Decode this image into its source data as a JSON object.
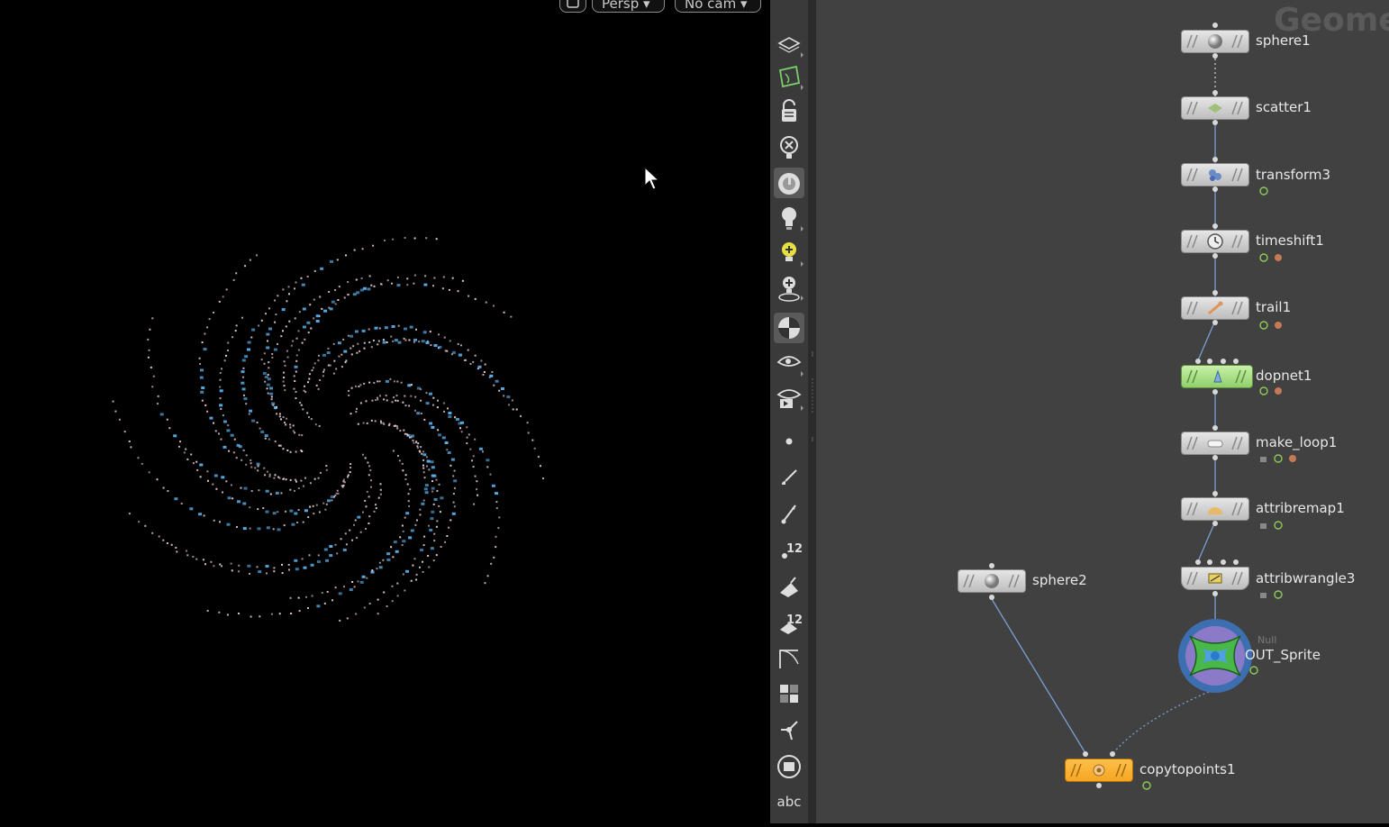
{
  "viewport": {
    "camera_menu": "Persp",
    "cam_menu": "No cam",
    "particle_colors": {
      "blue": "#5aaee8",
      "pink": "#e8cbd6"
    }
  },
  "toolbar": {
    "items": [
      "select-mode",
      "ghost-mode",
      "lock",
      "close",
      "display-options",
      "light-bulb",
      "headlight",
      "add-light",
      "shading",
      "snapshot",
      "camera-flipbook",
      "point",
      "brush",
      "pen",
      "point-numbers",
      "paint",
      "primitive-numbers",
      "shape",
      "grid",
      "handle",
      "circle-display"
    ],
    "text_button": "abc"
  },
  "network": {
    "title": "Geome",
    "nodes": [
      {
        "id": "sphere1",
        "label": "sphere1"
      },
      {
        "id": "scatter1",
        "label": "scatter1"
      },
      {
        "id": "transform3",
        "label": "transform3"
      },
      {
        "id": "timeshift1",
        "label": "timeshift1"
      },
      {
        "id": "trail1",
        "label": "trail1"
      },
      {
        "id": "dopnet1",
        "label": "dopnet1"
      },
      {
        "id": "make_loop1",
        "label": "make_loop1"
      },
      {
        "id": "attribremap1",
        "label": "attribremap1"
      },
      {
        "id": "attribwrangle3",
        "label": "attribwrangle3"
      },
      {
        "id": "out_sprite",
        "label": "OUT_Sprite",
        "type_label": "Null"
      },
      {
        "id": "sphere2",
        "label": "sphere2"
      },
      {
        "id": "copytopoints1",
        "label": "copytopoints1"
      }
    ],
    "colors": {
      "node": "#d4d4d4",
      "dopnet": "#a8e08c",
      "copy": "#f5a623",
      "null_ring": "#3d6fb0",
      "null_cross": "#48b84a"
    }
  }
}
